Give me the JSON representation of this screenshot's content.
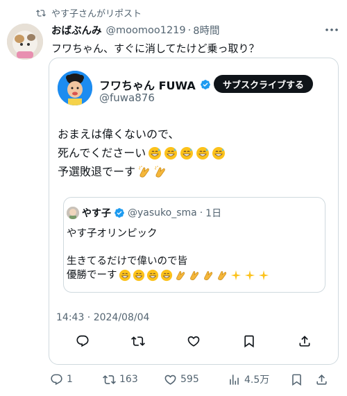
{
  "repost": {
    "icon": "repost-icon",
    "label": "やす子さんがリポスト"
  },
  "tweet": {
    "author_name": "おばぶんみ",
    "handle": "@moomoo1219",
    "separator": "·",
    "time": "8時間",
    "text": "フワちゃん、すぐに消してたけど乗っ取り？"
  },
  "quote": {
    "author_name": "フワちゃん FUWA",
    "handle": "@fuwa876",
    "subscribe_label": "サブスクライブする",
    "lines": [
      "おまえは偉くないので、",
      "死んでくださーい",
      "予選敗退でーす"
    ],
    "emojis": [
      "grinning-sweat",
      "clapping-hands"
    ],
    "nested": {
      "author_name": "やす子",
      "handle": "@yasuko_sma",
      "separator": "·",
      "time": "1日",
      "lines": [
        "やす子オリンピック",
        "",
        "生きてるだけで偉いので皆",
        "優勝でーす"
      ]
    },
    "date": "14:43 · 2024/08/04"
  },
  "actions": {
    "reply_count": "1",
    "repost_count": "163",
    "like_count": "595",
    "views_count": "4.5万"
  },
  "colors": {
    "text": "#0f1419",
    "muted": "#536471",
    "verified": "#1d9bf0",
    "border": "#cfd9de"
  }
}
